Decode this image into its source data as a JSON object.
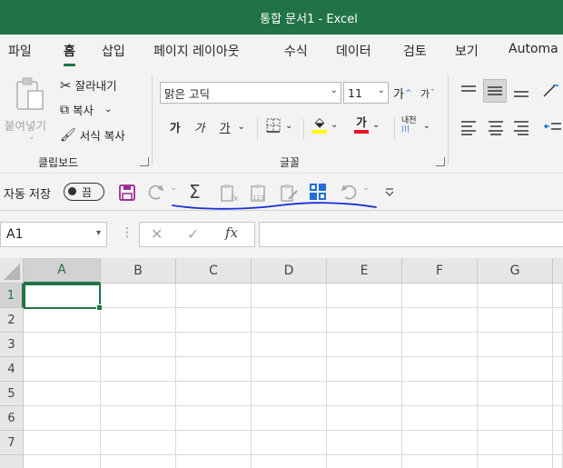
{
  "window": {
    "title": "통합 문서1  -  Excel"
  },
  "tabs": [
    "파일",
    "홈",
    "삽입",
    "페이지 레이아웃",
    "수식",
    "데이터",
    "검토",
    "보기",
    "Automa"
  ],
  "active_tab": "홈",
  "clipboard": {
    "paste_label": "붙여넣기",
    "cut_label": "잘라내기",
    "copy_label": "복사",
    "format_painter_label": "서식 복사",
    "group_label": "클립보드"
  },
  "font": {
    "font_name": "맑은 고딕",
    "font_size": "11",
    "grow_label": "가",
    "shrink_label": "가",
    "bold_label": "가",
    "italic_label": "가",
    "underline_label": "가",
    "font_color_label": "가",
    "phonetic_label": "내천",
    "group_label": "글꼴",
    "highlight_color": "#ffff00",
    "font_color": "#e81123"
  },
  "qat": {
    "autosave_label": "자동 저장",
    "autosave_state": "끔"
  },
  "formula_bar": {
    "name_box": "A1",
    "formula": ""
  },
  "sheet": {
    "columns": [
      "A",
      "B",
      "C",
      "D",
      "E",
      "F",
      "G"
    ],
    "rows": [
      "1",
      "2",
      "3",
      "4",
      "5",
      "6",
      "7"
    ],
    "active_cell": "A1"
  },
  "colors": {
    "accent": "#217346",
    "annotation": "#1a2fd6"
  }
}
